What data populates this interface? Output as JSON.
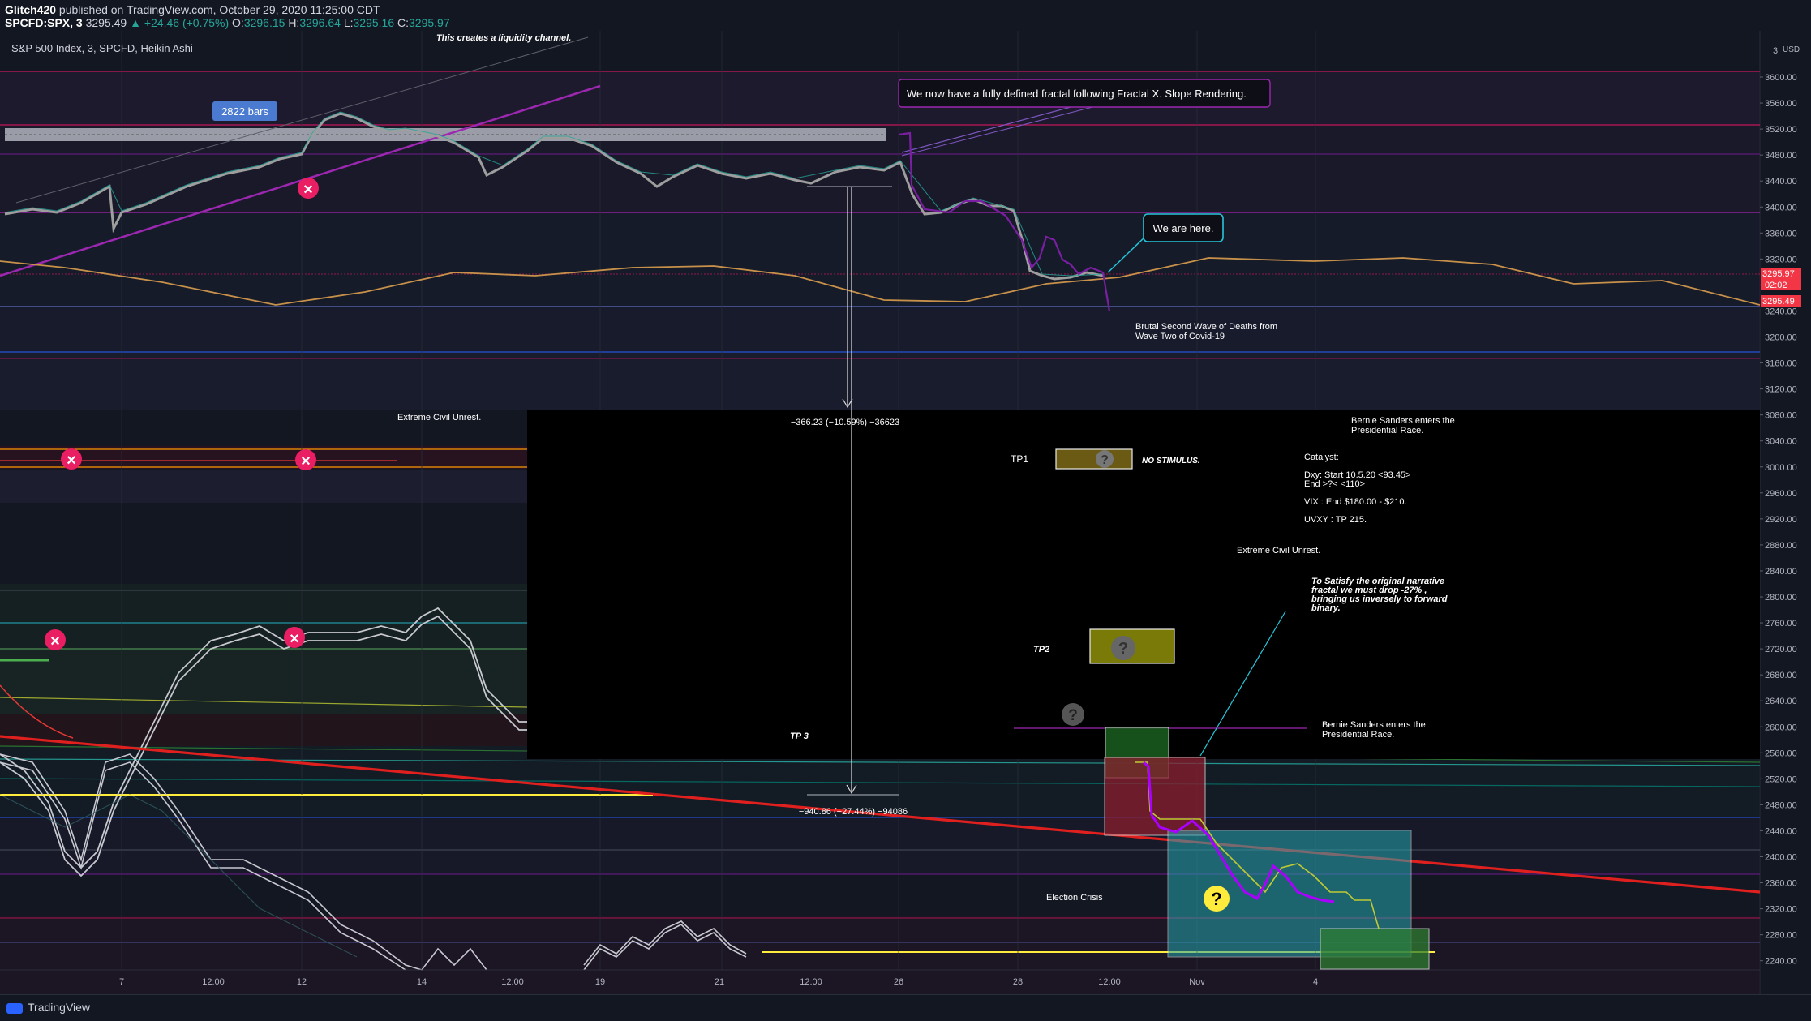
{
  "header": {
    "publisher": "Glitch420",
    "published_text": "published on TradingView.com, October 29, 2020 11:25:00 CDT",
    "symbol": "SPCFD:SPX, 3",
    "last": "3295.49",
    "change": "+24.46 (+0.75%)",
    "open_label": "O:",
    "open": "3296.15",
    "high_label": "H:",
    "high": "3296.64",
    "low_label": "L:",
    "low": "3295.16",
    "close_label": "C:",
    "close": "3295.97",
    "chart_title": "S&P 500 Index, 3, SPCFD, Heikin Ashi"
  },
  "axis": {
    "currency": "USD",
    "price_labels": [
      "3600.00",
      "3560.00",
      "3520.00",
      "3480.00",
      "3440.00",
      "3400.00",
      "3360.00",
      "3320.00",
      "3280.00",
      "3240.00",
      "3200.00",
      "3160.00",
      "3120.00",
      "3080.00",
      "3040.00",
      "3000.00",
      "2960.00",
      "2920.00",
      "2880.00",
      "2840.00",
      "2800.00",
      "2760.00",
      "2720.00",
      "2680.00",
      "2640.00",
      "2600.00",
      "2560.00",
      "2520.00",
      "2480.00",
      "2440.00",
      "2400.00",
      "2360.00",
      "2320.00",
      "2280.00",
      "2240.00"
    ],
    "time_labels": [
      "7",
      "12:00",
      "12",
      "14",
      "12:00",
      "19",
      "21",
      "12:00",
      "26",
      "28",
      "12:00",
      "Nov",
      "4"
    ],
    "current_price_1": "3295.97",
    "countdown": "02:02",
    "current_price_2": "3295.49",
    "scale_hint": "3"
  },
  "annotations": {
    "bars_badge": "2822 bars",
    "liquidity_note": "This creates a liquidity channel.",
    "fractal_note": "We now have a fully defined fractal following Fractal X. Slope Rendering.",
    "we_are_here": "We are here.",
    "second_wave_1": "Brutal Second Wave of Deaths from",
    "second_wave_2": "Wave Two of Covid-19",
    "civil_unrest_1": "Extreme Civil Unrest.",
    "civil_unrest_2": "Extreme Civil Unrest.",
    "measure_1": "−366.23 (−10.59%) −36623",
    "measure_2": "−940.86 (−27.44%) −94086",
    "tp1": "TP1",
    "tp2": "TP2",
    "tp3": "TP 3",
    "no_stimulus": "NO STIMULUS.",
    "bernie_top_1": "Bernie Sanders enters the",
    "bernie_top_2": "Presidential Race.",
    "bernie_bottom_1": "Bernie Sanders enters the",
    "bernie_bottom_2": "Presidential Race.",
    "catalyst_title": "Catalyst:",
    "catalyst_dxy_1": "Dxy: Start 10.5.20 <93.45>",
    "catalyst_dxy_2": "End >?< <110>",
    "catalyst_vix": "VIX : End $180.00 - $210.",
    "catalyst_uvxy": "UVXY : TP 215.",
    "satisfy_1": "To Satisfy the original narrative",
    "satisfy_2": "fractal we must drop -27% ,",
    "satisfy_3": "bringing us inversely to forward",
    "satisfy_4": "binary.",
    "election_crisis": "Election Crisis",
    "question": "?",
    "cross": "×"
  },
  "footer": {
    "brand": "TradingView"
  },
  "colors": {
    "background": "#131722",
    "up": "#26a69a",
    "down": "#ef5350",
    "purple": "#9c27b0",
    "teal": "#00bcd4",
    "orange_line": "#c8914a",
    "red_trend": "#e0201e",
    "yellow": "#ffeb3b",
    "price_tag": "#f23645"
  }
}
